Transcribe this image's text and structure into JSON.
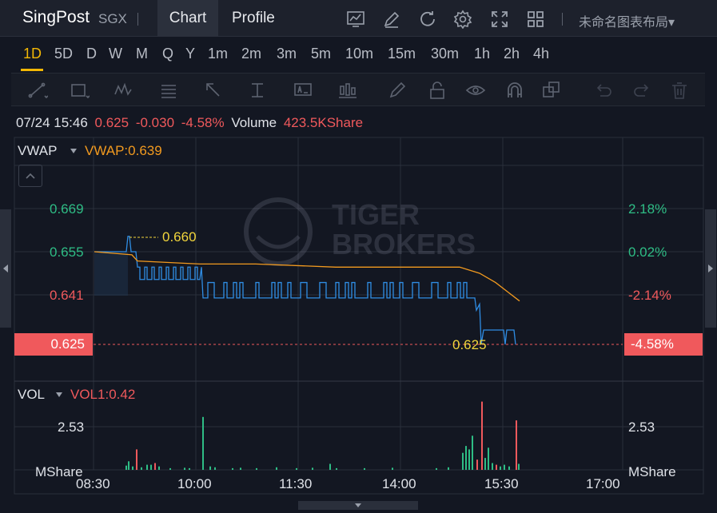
{
  "header": {
    "symbol": "SingPost",
    "exchange": "SGX",
    "tabs": {
      "chart": "Chart",
      "profile": "Profile"
    },
    "layout_name": "未命名图表布局▾",
    "icons": [
      "chart-type-icon",
      "draw-icon",
      "refresh-icon",
      "settings-icon",
      "fullscreen-icon",
      "layout-grid-icon"
    ]
  },
  "intervals": [
    "1D",
    "5D",
    "D",
    "W",
    "M",
    "Q",
    "Y",
    "1m",
    "2m",
    "3m",
    "5m",
    "10m",
    "15m",
    "30m",
    "1h",
    "2h",
    "4h"
  ],
  "active_interval": "1D",
  "drawing_tools": [
    "trend-line-icon",
    "rectangle-icon",
    "pattern-icon",
    "fib-icon",
    "arrow-icon",
    "measure-icon",
    "text-icon",
    "chart-pattern-icon",
    "brush-icon",
    "lock-icon",
    "eye-icon",
    "magnet-icon",
    "duplicate-icon",
    "undo-icon",
    "redo-icon",
    "trash-icon"
  ],
  "info": {
    "datetime": "07/24 15:46",
    "price": "0.625",
    "change": "-0.030",
    "change_pct": "-4.58%",
    "volume_label": "Volume",
    "volume": "423.5KShare"
  },
  "price_panel": {
    "indicator": "VWAP",
    "indicator_value": "VWAP:0.639",
    "left_ticks": [
      "0.669",
      "0.655",
      "0.641"
    ],
    "right_ticks": [
      "2.18%",
      "0.02%",
      "-2.14%"
    ],
    "current_price": "0.625",
    "current_pct": "-4.58%",
    "high_marker": "0.660",
    "low_marker": "0.625"
  },
  "volume_panel": {
    "indicator": "VOL",
    "indicator_value": "VOL1:0.42",
    "left_tick": "2.53",
    "right_tick": "2.53",
    "unit_left": "MShare",
    "unit_right": "MShare"
  },
  "time_axis": [
    "08:30",
    "10:00",
    "11:30",
    "14:00",
    "15:30",
    "17:00"
  ],
  "watermark": {
    "line1": "TIGER",
    "line2": "BROKERS"
  },
  "colors": {
    "up": "#2ebd85",
    "down": "#f0595c",
    "price_line": "#2f8de4",
    "vwap_line": "#f29a1f",
    "accent": "#f2b705"
  },
  "chart_data": {
    "type": "line",
    "x_labels": [
      "08:30",
      "10:00",
      "11:30",
      "14:00",
      "15:30",
      "17:00"
    ],
    "ylim": [
      0.625,
      0.669
    ],
    "series": [
      {
        "name": "VWAP",
        "values": [
          0.655,
          0.654,
          0.652,
          0.651,
          0.651,
          0.65,
          0.65,
          0.65,
          0.648,
          0.645,
          0.639
        ]
      }
    ],
    "current_price": 0.625,
    "day_high": 0.66,
    "day_low": 0.625,
    "volume_peak": 2.53
  }
}
